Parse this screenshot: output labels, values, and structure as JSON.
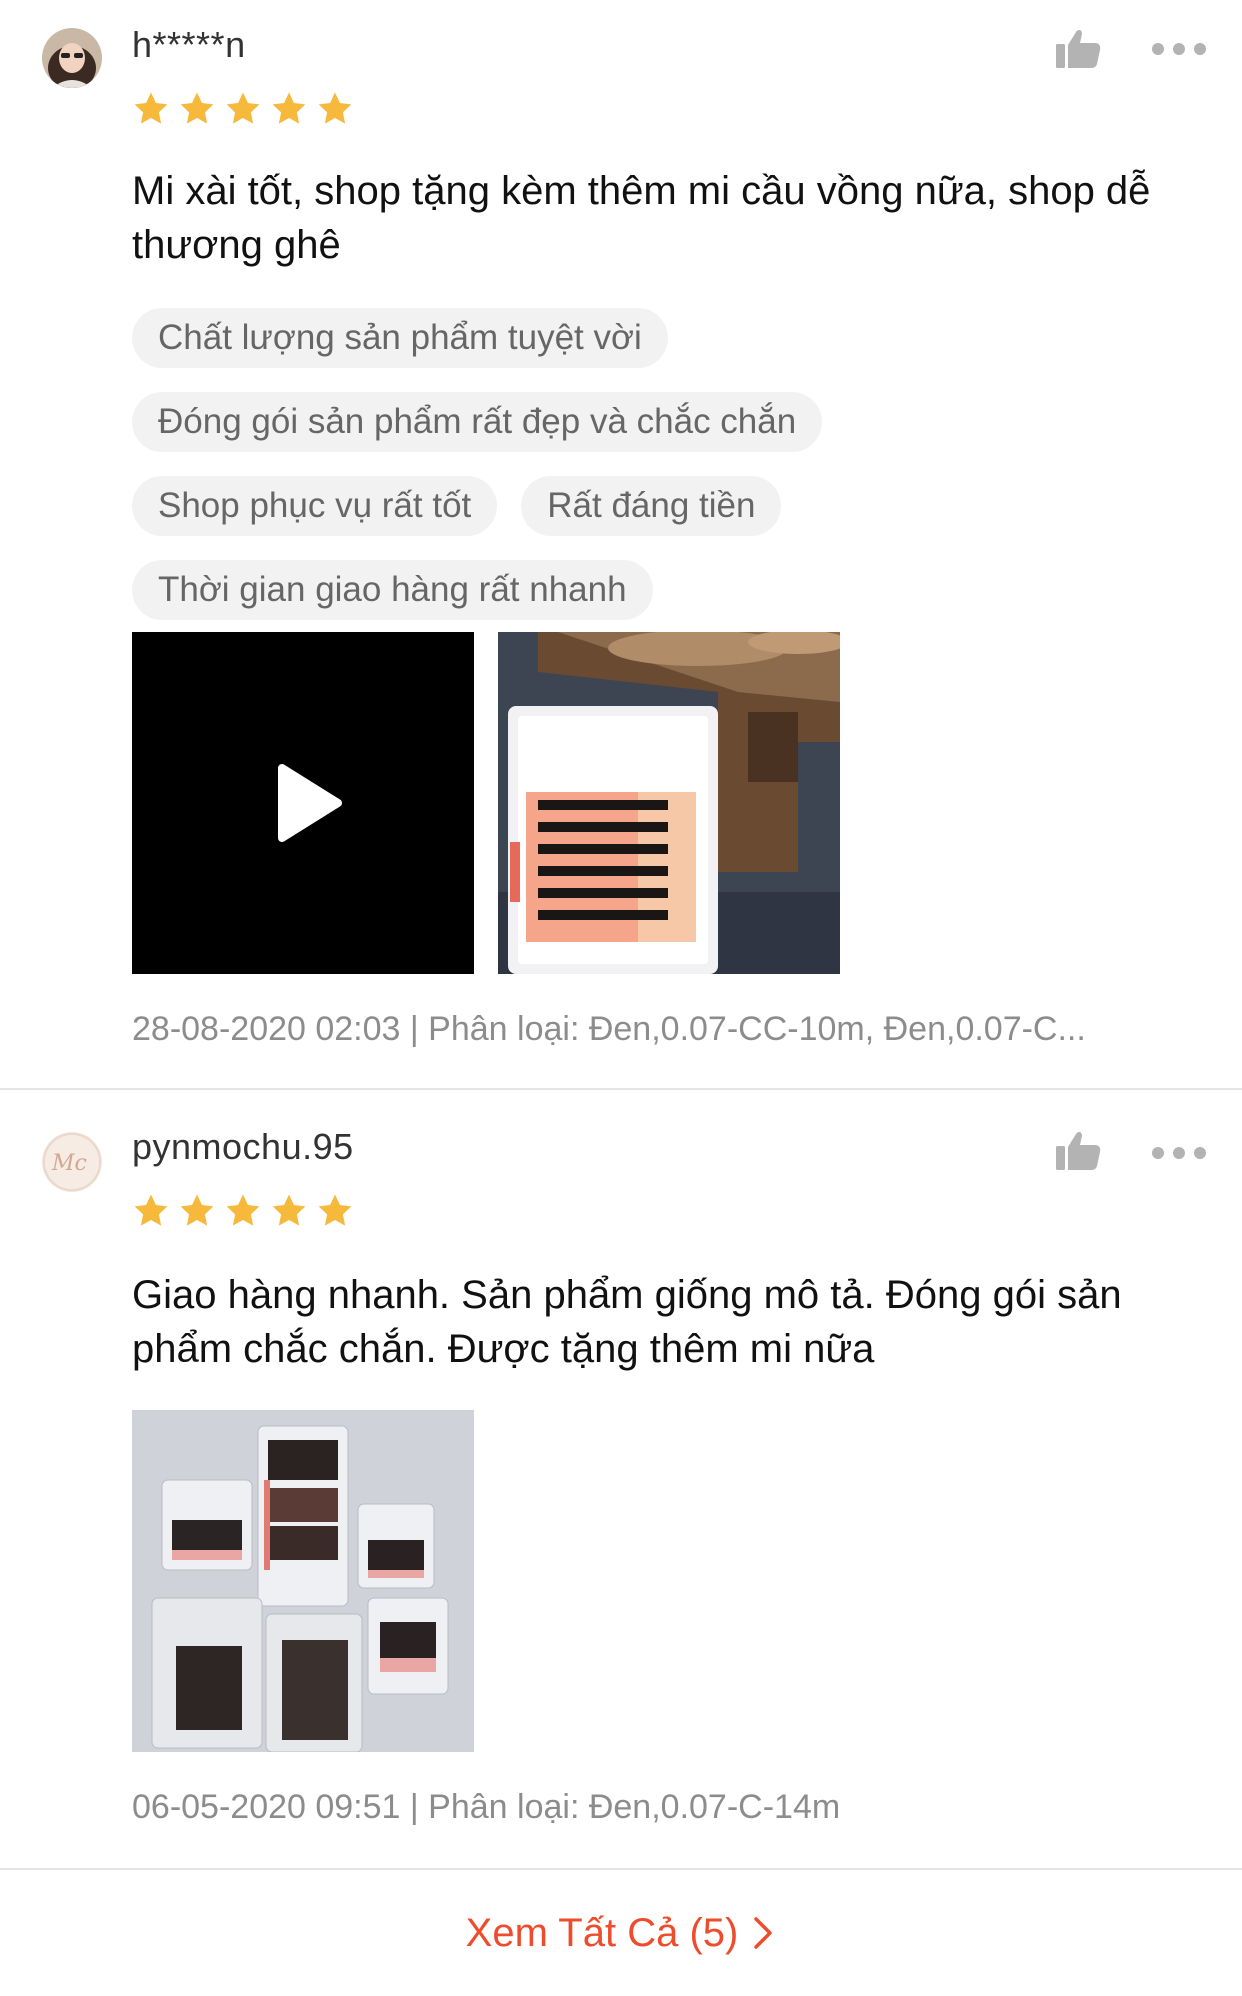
{
  "colors": {
    "accent": "#ee4d2d",
    "star": "#f6b93b",
    "muted_text": "#8c8c8c",
    "tag_bg": "#f2f2f2"
  },
  "reviews": [
    {
      "username": "h*****n",
      "rating": 5,
      "comment": "Mi xài tốt, shop tặng kèm thêm mi cầu vồng nữa, shop dễ thương ghê",
      "tags": [
        "Chất lượng sản phẩm tuyệt vời",
        "Đóng gói sản phẩm rất đẹp và chắc chắn",
        "Shop phục vụ rất tốt",
        "Rất đáng tiền",
        "Thời gian giao hàng rất nhanh"
      ],
      "media": [
        {
          "kind": "video",
          "icon": "play-icon"
        },
        {
          "kind": "photo",
          "subject": "eyelash-tray-photo"
        }
      ],
      "meta": "28-08-2020 02:03 | Phân loại: Đen,0.07-CC-10m, Đen,0.07-C..."
    },
    {
      "username": "pynmochu.95",
      "rating": 5,
      "comment": "Giao hàng nhanh. Sản phẩm giống mô tả. Đóng gói sản phẩm chắc chắn.  Được tặng thêm mi nữa",
      "tags": [],
      "media": [
        {
          "kind": "photo",
          "subject": "eyelash-boxes-photo"
        }
      ],
      "meta": "06-05-2020 09:51 | Phân loại: Đen,0.07-C-14m"
    }
  ],
  "footer": {
    "see_all_label": "Xem Tất Cả (5)",
    "chevron_icon": "chevron-right-icon"
  }
}
